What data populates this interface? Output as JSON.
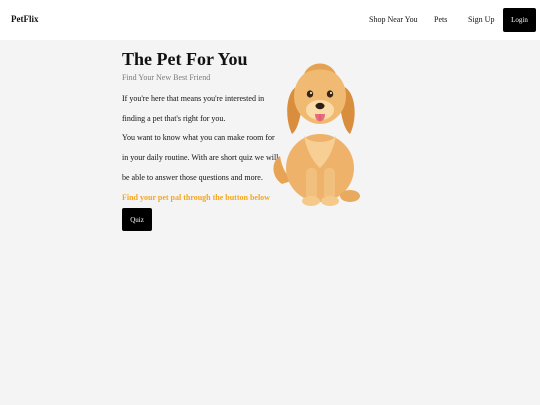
{
  "nav": {
    "brand": "PetFlix",
    "links": [
      "Shop Near You",
      "Pets",
      "Sign Up"
    ],
    "login_label": "Login"
  },
  "hero": {
    "title": "The Pet For You",
    "subtitle": "Find Your New Best Friend",
    "paragraph_lines": [
      "If you're here that means you're interested in",
      "finding a pet that's right for you.",
      "You want to know what you can make room for",
      "in your daily routine. With are short quiz we will",
      "be able to answer those questions and more."
    ],
    "cta": "Find your pet pal through the button below",
    "quiz_label": "Quiz"
  },
  "colors": {
    "accent": "#f5a623",
    "button_bg": "#000000",
    "page_bg": "#f4f4f4"
  },
  "images": {
    "hero_image": "golden-retriever-puppy"
  }
}
